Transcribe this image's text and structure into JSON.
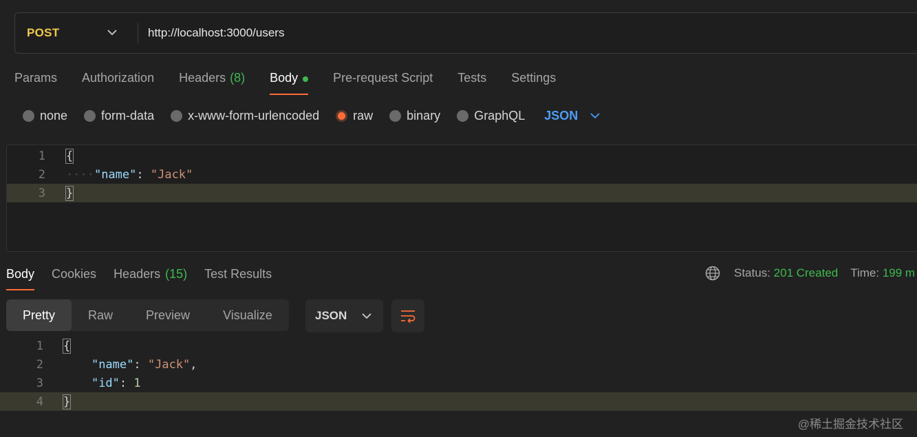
{
  "request": {
    "method": "POST",
    "url": "http://localhost:3000/users"
  },
  "request_tabs": [
    {
      "label": "Params"
    },
    {
      "label": "Authorization"
    },
    {
      "label": "Headers",
      "count": "(8)"
    },
    {
      "label": "Body",
      "active": true
    },
    {
      "label": "Pre-request Script"
    },
    {
      "label": "Tests"
    },
    {
      "label": "Settings"
    }
  ],
  "body_types": {
    "options": [
      "none",
      "form-data",
      "x-www-form-urlencoded",
      "raw",
      "binary",
      "GraphQL"
    ],
    "selected": "raw",
    "format": "JSON"
  },
  "request_body": {
    "line_numbers": [
      "1",
      "2",
      "3"
    ],
    "open_brace": "{",
    "key": "\"name\"",
    "colon": ": ",
    "value": "\"Jack\"",
    "close_brace": "}"
  },
  "response_tabs": [
    {
      "label": "Body",
      "active": true
    },
    {
      "label": "Cookies"
    },
    {
      "label": "Headers",
      "count": "(15)"
    },
    {
      "label": "Test Results"
    }
  ],
  "status": {
    "status_label": "Status:",
    "status_value": "201 Created",
    "time_label": "Time:",
    "time_value": "199 m"
  },
  "view_modes": [
    "Pretty",
    "Raw",
    "Preview",
    "Visualize"
  ],
  "response_format": "JSON",
  "response_body": {
    "line_numbers": [
      "1",
      "2",
      "3",
      "4"
    ],
    "open_brace": "{",
    "key1": "\"name\"",
    "value1": "\"Jack\"",
    "key2": "\"id\"",
    "value2": "1",
    "close_brace": "}"
  },
  "watermark": "@稀土掘金技术社区",
  "colors": {
    "accent": "#ff6c37",
    "method": "#f2c94c",
    "success": "#3fb950",
    "json_select": "#4d9cf6"
  }
}
